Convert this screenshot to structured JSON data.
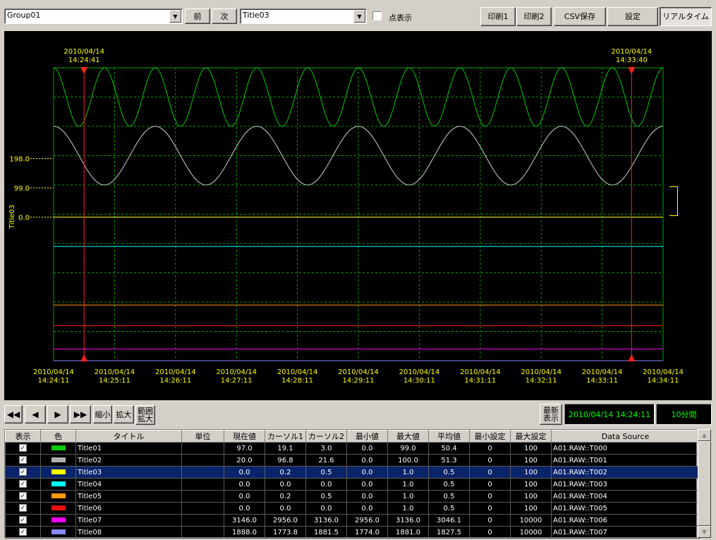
{
  "toolbar": {
    "group_select": "Group01",
    "prev_label": "前",
    "next_label": "次",
    "title_select": "Title03",
    "dot_display_label": "点表示",
    "print1_label": "印刷1",
    "print2_label": "印刷2",
    "csv_label": "CSV保存",
    "settings_label": "設定",
    "realtime_label": "リアルタイム"
  },
  "chart_data": {
    "type": "line",
    "y_axis_title": "Title03",
    "y_tick_labels": [
      "198.0",
      "99.0",
      "0.0"
    ],
    "cursor1": {
      "date": "2010/04/14",
      "time": "14:24:41"
    },
    "cursor2": {
      "date": "2010/04/14",
      "time": "14:33:40"
    },
    "x_tick_labels": [
      {
        "date": "2010/04/14",
        "time": "14:24:11"
      },
      {
        "date": "2010/04/14",
        "time": "14:25:11"
      },
      {
        "date": "2010/04/14",
        "time": "14:26:11"
      },
      {
        "date": "2010/04/14",
        "time": "14:27:11"
      },
      {
        "date": "2010/04/14",
        "time": "14:28:11"
      },
      {
        "date": "2010/04/14",
        "time": "14:29:11"
      },
      {
        "date": "2010/04/14",
        "time": "14:30:11"
      },
      {
        "date": "2010/04/14",
        "time": "14:31:11"
      },
      {
        "date": "2010/04/14",
        "time": "14:32:11"
      },
      {
        "date": "2010/04/14",
        "time": "14:33:11"
      },
      {
        "date": "2010/04/14",
        "time": "14:34:11"
      }
    ],
    "grid": true,
    "series": [
      {
        "name": "Title01",
        "color": "#00cc00",
        "shape": "sine",
        "cycles": 12,
        "level": 0.9,
        "amp": 0.1
      },
      {
        "name": "Title02",
        "color": "#d0d0d0",
        "shape": "sine",
        "cycles": 6,
        "level": 0.7,
        "amp": 0.1
      },
      {
        "name": "Title03",
        "color": "#ffff00",
        "shape": "flat",
        "level": 0.49
      },
      {
        "name": "Title04",
        "color": "#00ffff",
        "shape": "flat",
        "level": 0.39
      },
      {
        "name": "Title05",
        "color": "#ff9900",
        "shape": "flat",
        "level": 0.19
      },
      {
        "name": "Title06",
        "color": "#ff2020",
        "shape": "flat",
        "level": 0.12
      },
      {
        "name": "Title07",
        "color": "#ff00ff",
        "shape": "flat",
        "level": 0.04
      },
      {
        "name": "Title08",
        "color": "#8888ff",
        "shape": "flat",
        "level": 0.0
      }
    ]
  },
  "nav": {
    "first_icon": "skip-first-icon",
    "prev_icon": "step-back-icon",
    "next_icon": "step-forward-icon",
    "last_icon": "skip-last-icon",
    "zoom_out_label": "縮小",
    "zoom_in_label": "拡大",
    "range_label_1": "範囲",
    "range_label_2": "拡大",
    "latest_label_1": "最新",
    "latest_label_2": "表示",
    "start_time": "2010/04/14 14:24:11",
    "span": "10分間"
  },
  "table": {
    "headers": [
      "表示",
      "色",
      "タイトル",
      "単位",
      "現在値",
      "カーソル1",
      "カーソル2",
      "最小値",
      "最大値",
      "平均値",
      "最小設定",
      "最大設定",
      "Data Source"
    ],
    "rows": [
      {
        "check": "✓",
        "color": "#00cc00",
        "title": "Title01",
        "unit": "",
        "current": "97.0",
        "c1": "19.1",
        "c2": "3.0",
        "min": "0.0",
        "max": "99.0",
        "avg": "50.4",
        "min_set": "0",
        "max_set": "100",
        "source": "A01.RAW::T000"
      },
      {
        "check": "✓",
        "color": "#b0b0b0",
        "title": "Title02",
        "unit": "",
        "current": "20.0",
        "c1": "96.8",
        "c2": "21.6",
        "min": "0.0",
        "max": "100.0",
        "avg": "51.3",
        "min_set": "0",
        "max_set": "100",
        "source": "A01.RAW::T001"
      },
      {
        "check": "✓",
        "color": "#ffff00",
        "title": "Title03",
        "unit": "",
        "current": "0.0",
        "c1": "0.2",
        "c2": "0.5",
        "min": "0.0",
        "max": "1.0",
        "avg": "0.5",
        "min_set": "0",
        "max_set": "100",
        "source": "A01.RAW::T002"
      },
      {
        "check": "✓",
        "color": "#00ffff",
        "title": "Title04",
        "unit": "",
        "current": "0.0",
        "c1": "0.0",
        "c2": "0.0",
        "min": "0.0",
        "max": "1.0",
        "avg": "0.5",
        "min_set": "0",
        "max_set": "100",
        "source": "A01.RAW::T003"
      },
      {
        "check": "✓",
        "color": "#ff9900",
        "title": "Title05",
        "unit": "",
        "current": "0.0",
        "c1": "0.2",
        "c2": "0.5",
        "min": "0.0",
        "max": "1.0",
        "avg": "0.5",
        "min_set": "0",
        "max_set": "100",
        "source": "A01.RAW::T004"
      },
      {
        "check": "✓",
        "color": "#ee1010",
        "title": "Title06",
        "unit": "",
        "current": "0.0",
        "c1": "0.0",
        "c2": "0.0",
        "min": "0.0",
        "max": "1.0",
        "avg": "0.5",
        "min_set": "0",
        "max_set": "100",
        "source": "A01.RAW::T005"
      },
      {
        "check": "✓",
        "color": "#ff00ff",
        "title": "Title07",
        "unit": "",
        "current": "3146.0",
        "c1": "2956.0",
        "c2": "3136.0",
        "min": "2956.0",
        "max": "3136.0",
        "avg": "3046.1",
        "min_set": "0",
        "max_set": "10000",
        "source": "A01.RAW::T006"
      },
      {
        "check": "✓",
        "color": "#8888ff",
        "title": "Title08",
        "unit": "",
        "current": "1888.0",
        "c1": "1773.8",
        "c2": "1881.5",
        "min": "1774.0",
        "max": "1881.0",
        "avg": "1827.5",
        "min_set": "0",
        "max_set": "10000",
        "source": "A01.RAW::T007"
      }
    ],
    "selected_index": 2
  }
}
